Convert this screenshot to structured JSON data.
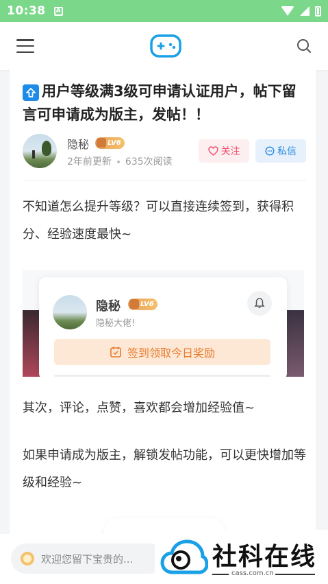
{
  "statusbar": {
    "time": "10:38",
    "a_icon": "A"
  },
  "topnav": {
    "menu_icon": "hamburger-icon",
    "logo_icon": "gamepad-icon",
    "search_icon": "search-icon"
  },
  "post": {
    "title": "用户等级满3级可申请认证用户，帖下留言可申请成为版主，发帖！！",
    "author": {
      "name": "隐秘",
      "level": "LV6",
      "updated": "2年前更新",
      "reads": "635次阅读"
    },
    "follow_label": "关注",
    "message_label": "私信",
    "paragraphs": [
      "不知道怎么提升等级？可以直接连续签到，获得积分、经验速度最快~",
      "其次，评论，点赞，喜欢都会增加经验值~",
      "如果申请成为版主，解锁发帖功能，可以更快增加等级和经验~"
    ],
    "embedded_screenshot": {
      "name": "隐秘",
      "level": "LV6",
      "subtitle": "隐秘大佬!",
      "sign_button": "签到领取今日奖励"
    }
  },
  "comment": {
    "placeholder": "欢迎您留下宝贵的..."
  },
  "watermark": {
    "text": "社科在线",
    "domain": "cass.com.cn"
  },
  "colors": {
    "statusbar": "#7bd88a",
    "accent_blue": "#1e8ce6",
    "follow_pink": "#f0506e",
    "sign_orange": "#e87a2c"
  }
}
